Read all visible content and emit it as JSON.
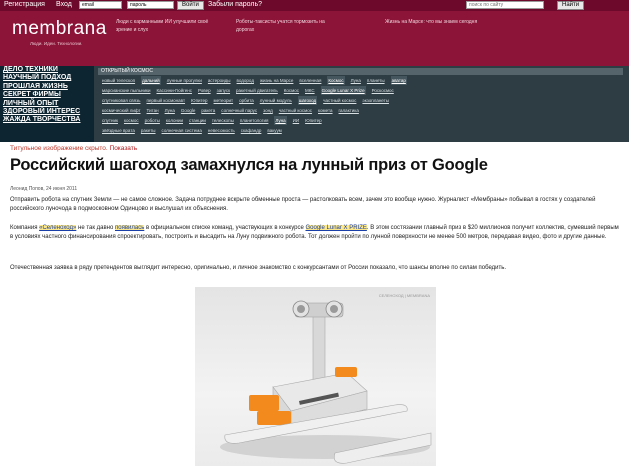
{
  "login": {
    "register": "Регистрация",
    "enter": "Вход",
    "email_value": "email",
    "password_value": "пароль",
    "submit": "Войти",
    "forgot": "Забыли пароль?",
    "search_placeholder": "поиск по сайту",
    "search_button": "Найти"
  },
  "header": {
    "logo": "membrana",
    "tagline": "Люди. Идеи. Технологии.",
    "news": [
      "Люди с карманными ИИ улучшили своё зрение и слух",
      "Роботы-таксисты учатся тормозить на дорогах",
      "Жизнь на Марсе: что мы знаем сегодня"
    ]
  },
  "categories": [
    "ДЕЛО ТЕХНИКИ",
    "НАУЧНЫЙ ПОДХОД",
    "ПРОШЛАЯ ЖИЗНЬ",
    "СЕКРЕТ ФИРМЫ",
    "ЛИЧНЫЙ ОПЫТ",
    "ЗДОРОВЫЙ ИНТЕРЕС",
    "ЖАЖДА ТВОРЧЕСТВА"
  ],
  "tags": {
    "header": "ОТКРЫТЫЙ КОСМОС",
    "rows": [
      [
        "новый телескоп",
        "дальний",
        "лунные прогулки",
        "астероиды",
        "водород",
        "жизнь на Марсе",
        "вселенная",
        "Космос",
        "Луна",
        "планеты",
        "аватар"
      ],
      [
        "марсианские пыльники",
        "Кассини-Гюйгенс",
        "Ровер",
        "запуск",
        "ракетный двигатель",
        "Космос",
        "МКС",
        "Google Lunar X Prize",
        "Роскосмос"
      ],
      [
        "спутниковая связь",
        "первый космонавт",
        "Юпитер",
        "метеорит",
        "орбита",
        "лунный модуль",
        "шагоход",
        "частный космос",
        "экзопланеты"
      ],
      [
        "космический лифт",
        "Титан",
        "Луна",
        "Google",
        "ракета",
        "солнечный парус",
        "зонд",
        "частный космос",
        "комета",
        "галактика"
      ],
      [
        "спутник",
        "космос",
        "роботы",
        "колонии",
        "станции",
        "телескопы",
        "планетология",
        "Луна",
        "ИИ",
        "Юпитер"
      ],
      [
        "звёздные врата",
        "ракеты",
        "солнечная система",
        "невесомость",
        "скафандр",
        "вакуум"
      ]
    ]
  },
  "article": {
    "hidden_note": "Титульное изображение скрыто.",
    "show_link": "Показать",
    "title": "Российский шагоход замахнулся на лунный приз от Google",
    "byline": "Леонид Попов, 24 июня 2011",
    "p1": "Отправить робота на спутник Земли — не самое сложное. Задача потруднее вскрыте обменные проста — растолковать всем, зачем это вообще нужно. Журналист «Мембраны» побывал в гостях у создателей российского луночода в подмосковном Одинцово и выслушал их объяснения.",
    "p2_parts": {
      "a": "Компания ",
      "link1": "«Селеноход»",
      "b": " не так давно ",
      "link2": "появилась",
      "c": " в официальном списке команд, участвующих в конкурсе ",
      "link3": "Google Lunar X PRIZE",
      "d": ". В этом состязании главный приз в $20 миллионов получит коллектив, сумевший первым в условиях частного финансирования спроектировать, построить и высадить на Луну подвижного робота. Тот должен пройти по лунной поверхности не менее 500 метров, передавая видео, фото и другие данные."
    },
    "p3": "Отечественная заявка в ряду претендентов выглядит интересно, оригинально, и личное знакомство с конкурсантами от России показало, что шансы вполне по силам победить.",
    "photo_credit": "СЕЛЕНОХОД | MEMBRANA"
  },
  "colors": {
    "header_bg": "#8c1438",
    "login_bg": "#6d0a2b",
    "nav_bg": "#0d2530",
    "tags_bg": "#2e3d44",
    "robot_orange": "#f28a1e"
  }
}
